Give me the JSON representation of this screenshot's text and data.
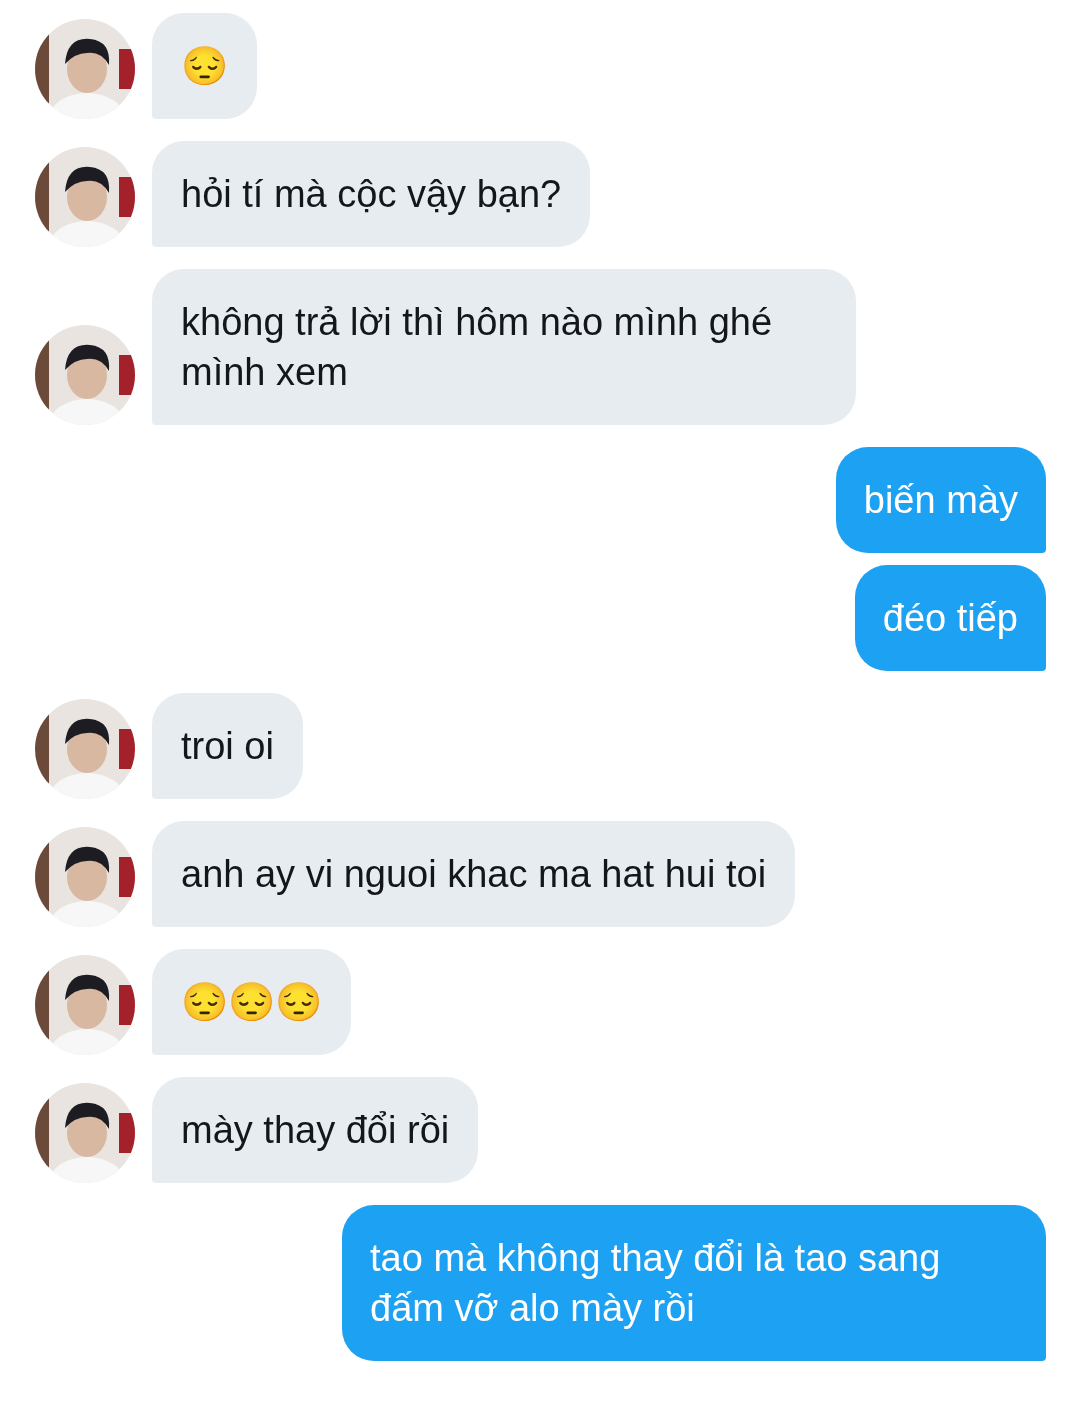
{
  "messages": [
    {
      "outgoing": false,
      "text": "😔"
    },
    {
      "outgoing": false,
      "text": "hỏi tí mà cộc vậy bạn?"
    },
    {
      "outgoing": false,
      "text": "không trả lời thì hôm nào mình ghé mình xem"
    },
    {
      "outgoing": true,
      "text": "biến mày"
    },
    {
      "outgoing": true,
      "text": "đéo tiếp"
    },
    {
      "outgoing": false,
      "text": "troi oi"
    },
    {
      "outgoing": false,
      "text": "anh ay vi nguoi khac ma hat hui toi"
    },
    {
      "outgoing": false,
      "text": "😔😔😔"
    },
    {
      "outgoing": false,
      "text": "mày thay đổi rồi"
    },
    {
      "outgoing": true,
      "text": "tao mà không thay đổi là tao sang đấm vỡ alo mày rồi"
    }
  ]
}
